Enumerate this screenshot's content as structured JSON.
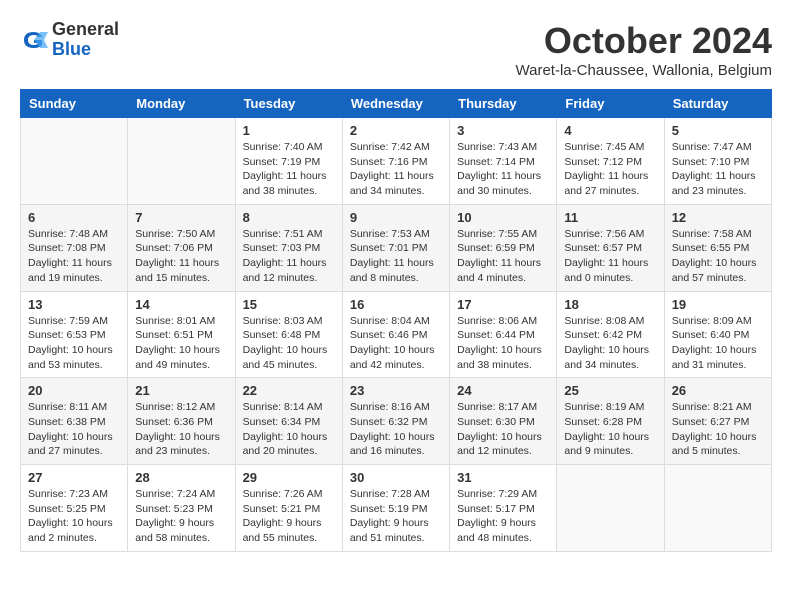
{
  "header": {
    "logo_general": "General",
    "logo_blue": "Blue",
    "month_title": "October 2024",
    "subtitle": "Waret-la-Chaussee, Wallonia, Belgium"
  },
  "weekdays": [
    "Sunday",
    "Monday",
    "Tuesday",
    "Wednesday",
    "Thursday",
    "Friday",
    "Saturday"
  ],
  "weeks": [
    [
      {
        "day": "",
        "info": ""
      },
      {
        "day": "",
        "info": ""
      },
      {
        "day": "1",
        "info": "Sunrise: 7:40 AM\nSunset: 7:19 PM\nDaylight: 11 hours and 38 minutes."
      },
      {
        "day": "2",
        "info": "Sunrise: 7:42 AM\nSunset: 7:16 PM\nDaylight: 11 hours and 34 minutes."
      },
      {
        "day": "3",
        "info": "Sunrise: 7:43 AM\nSunset: 7:14 PM\nDaylight: 11 hours and 30 minutes."
      },
      {
        "day": "4",
        "info": "Sunrise: 7:45 AM\nSunset: 7:12 PM\nDaylight: 11 hours and 27 minutes."
      },
      {
        "day": "5",
        "info": "Sunrise: 7:47 AM\nSunset: 7:10 PM\nDaylight: 11 hours and 23 minutes."
      }
    ],
    [
      {
        "day": "6",
        "info": "Sunrise: 7:48 AM\nSunset: 7:08 PM\nDaylight: 11 hours and 19 minutes."
      },
      {
        "day": "7",
        "info": "Sunrise: 7:50 AM\nSunset: 7:06 PM\nDaylight: 11 hours and 15 minutes."
      },
      {
        "day": "8",
        "info": "Sunrise: 7:51 AM\nSunset: 7:03 PM\nDaylight: 11 hours and 12 minutes."
      },
      {
        "day": "9",
        "info": "Sunrise: 7:53 AM\nSunset: 7:01 PM\nDaylight: 11 hours and 8 minutes."
      },
      {
        "day": "10",
        "info": "Sunrise: 7:55 AM\nSunset: 6:59 PM\nDaylight: 11 hours and 4 minutes."
      },
      {
        "day": "11",
        "info": "Sunrise: 7:56 AM\nSunset: 6:57 PM\nDaylight: 11 hours and 0 minutes."
      },
      {
        "day": "12",
        "info": "Sunrise: 7:58 AM\nSunset: 6:55 PM\nDaylight: 10 hours and 57 minutes."
      }
    ],
    [
      {
        "day": "13",
        "info": "Sunrise: 7:59 AM\nSunset: 6:53 PM\nDaylight: 10 hours and 53 minutes."
      },
      {
        "day": "14",
        "info": "Sunrise: 8:01 AM\nSunset: 6:51 PM\nDaylight: 10 hours and 49 minutes."
      },
      {
        "day": "15",
        "info": "Sunrise: 8:03 AM\nSunset: 6:48 PM\nDaylight: 10 hours and 45 minutes."
      },
      {
        "day": "16",
        "info": "Sunrise: 8:04 AM\nSunset: 6:46 PM\nDaylight: 10 hours and 42 minutes."
      },
      {
        "day": "17",
        "info": "Sunrise: 8:06 AM\nSunset: 6:44 PM\nDaylight: 10 hours and 38 minutes."
      },
      {
        "day": "18",
        "info": "Sunrise: 8:08 AM\nSunset: 6:42 PM\nDaylight: 10 hours and 34 minutes."
      },
      {
        "day": "19",
        "info": "Sunrise: 8:09 AM\nSunset: 6:40 PM\nDaylight: 10 hours and 31 minutes."
      }
    ],
    [
      {
        "day": "20",
        "info": "Sunrise: 8:11 AM\nSunset: 6:38 PM\nDaylight: 10 hours and 27 minutes."
      },
      {
        "day": "21",
        "info": "Sunrise: 8:12 AM\nSunset: 6:36 PM\nDaylight: 10 hours and 23 minutes."
      },
      {
        "day": "22",
        "info": "Sunrise: 8:14 AM\nSunset: 6:34 PM\nDaylight: 10 hours and 20 minutes."
      },
      {
        "day": "23",
        "info": "Sunrise: 8:16 AM\nSunset: 6:32 PM\nDaylight: 10 hours and 16 minutes."
      },
      {
        "day": "24",
        "info": "Sunrise: 8:17 AM\nSunset: 6:30 PM\nDaylight: 10 hours and 12 minutes."
      },
      {
        "day": "25",
        "info": "Sunrise: 8:19 AM\nSunset: 6:28 PM\nDaylight: 10 hours and 9 minutes."
      },
      {
        "day": "26",
        "info": "Sunrise: 8:21 AM\nSunset: 6:27 PM\nDaylight: 10 hours and 5 minutes."
      }
    ],
    [
      {
        "day": "27",
        "info": "Sunrise: 7:23 AM\nSunset: 5:25 PM\nDaylight: 10 hours and 2 minutes."
      },
      {
        "day": "28",
        "info": "Sunrise: 7:24 AM\nSunset: 5:23 PM\nDaylight: 9 hours and 58 minutes."
      },
      {
        "day": "29",
        "info": "Sunrise: 7:26 AM\nSunset: 5:21 PM\nDaylight: 9 hours and 55 minutes."
      },
      {
        "day": "30",
        "info": "Sunrise: 7:28 AM\nSunset: 5:19 PM\nDaylight: 9 hours and 51 minutes."
      },
      {
        "day": "31",
        "info": "Sunrise: 7:29 AM\nSunset: 5:17 PM\nDaylight: 9 hours and 48 minutes."
      },
      {
        "day": "",
        "info": ""
      },
      {
        "day": "",
        "info": ""
      }
    ]
  ]
}
